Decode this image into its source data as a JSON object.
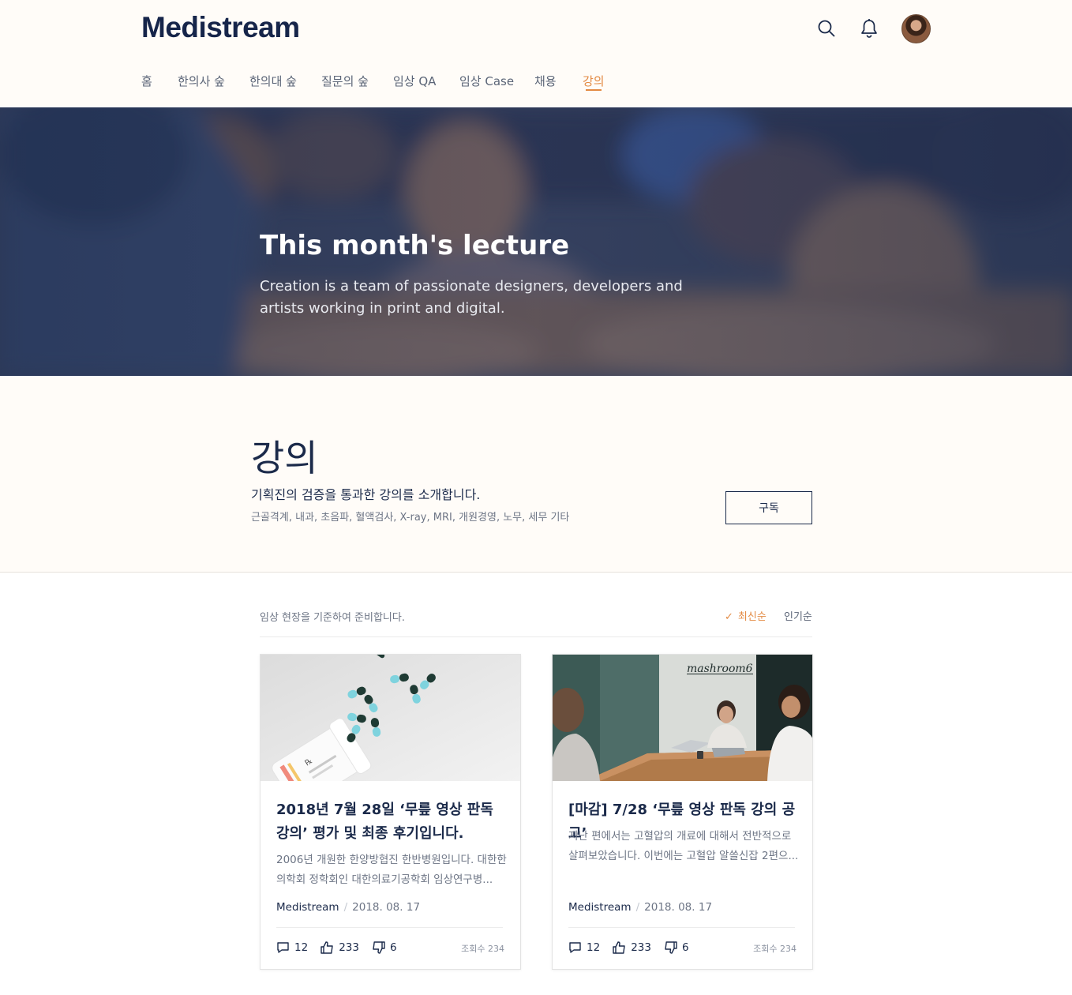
{
  "brand": {
    "name": "Medistream"
  },
  "header": {
    "icons": [
      "search-icon",
      "bell-icon",
      "avatar"
    ],
    "nav": [
      "홈",
      "한의사 숲",
      "한의대 숲",
      "질문의 숲",
      "임상 QA",
      "임상 Case",
      "채용",
      "강의"
    ],
    "active_nav": "강의"
  },
  "hero": {
    "title": "This month's lecture",
    "subtitle": "Creation is a team of passionate designers, developers and artists working in print and digital."
  },
  "intro": {
    "title": "강의",
    "description": "기획진의 검증을 통과한 강의를 소개합니다.",
    "tags": "근골격계, 내과, 초음파, 혈액검사, X-ray, MRI, 개원경영, 노무, 세무 기타",
    "subscribe_label": "구독"
  },
  "list": {
    "note": "임상 현장을 기준하여 준비합니다.",
    "sort_latest": "최신순",
    "sort_popular": "인기순",
    "active_sort": "최신순",
    "cards": [
      {
        "title": "2018년 7월 28일 ‘무릎 영상 판독 강의’ 평가 및 최종 후기입니다.",
        "excerpt": "2006년 개원한 한양방협진 한반병원입니다. 대한한의학회 정학회인 대한의료기공학회 임상연구병...",
        "author": "Medistream",
        "date": "2018. 08. 17",
        "comments": "12",
        "likes": "233",
        "dislikes": "6",
        "views": "조회수 234",
        "image": "pills-image"
      },
      {
        "title": "[마감] 7/28 ‘무릎 영상 판독 강의 공고’",
        "excerpt": "지난 편에서는 고혈압의 개료에 대해서 전반적으로 살펴보았습니다. 이번에는 고혈압 알쓸신잡 2편으...",
        "author": "Medistream",
        "date": "2018. 08. 17",
        "comments": "12",
        "likes": "233",
        "dislikes": "6",
        "views": "조회수 234",
        "image": "meeting-image",
        "image_sign": "mashroom6"
      }
    ]
  },
  "colors": {
    "accent": "#e38a43",
    "navy": "#1b2a4a",
    "background": "#fffcf8"
  }
}
